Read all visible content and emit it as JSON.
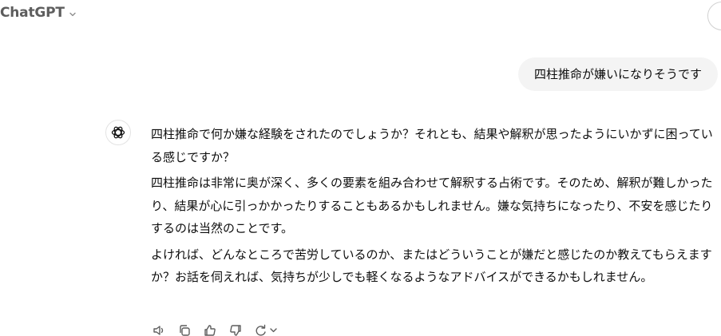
{
  "header": {
    "model_name": "ChatGPT"
  },
  "conversation": {
    "user_message": "四柱推命が嫌いになりそうです",
    "assistant_paragraphs": [
      "四柱推命で何か嫌な経験をされたのでしょうか？それとも、結果や解釈が思ったようにいかずに困っている感じですか？",
      "四柱推命は非常に奥が深く、多くの要素を組み合わせて解釈する占術です。そのため、解釈が難しかったり、結果が心に引っかかったりすることもあるかもしれません。嫌な気持ちになったり、不安を感じたりするのは当然のことです。",
      "よければ、どんなところで苦労しているのか、またはどういうことが嫌だと感じたのか教えてもらえますか？お話を伺えれば、気持ちが少しでも軽くなるようなアドバイスができるかもしれません。"
    ]
  },
  "actions": {
    "icons": [
      "speaker-icon",
      "copy-icon",
      "thumbs-up-icon",
      "thumbs-down-icon",
      "regenerate-icon"
    ]
  }
}
